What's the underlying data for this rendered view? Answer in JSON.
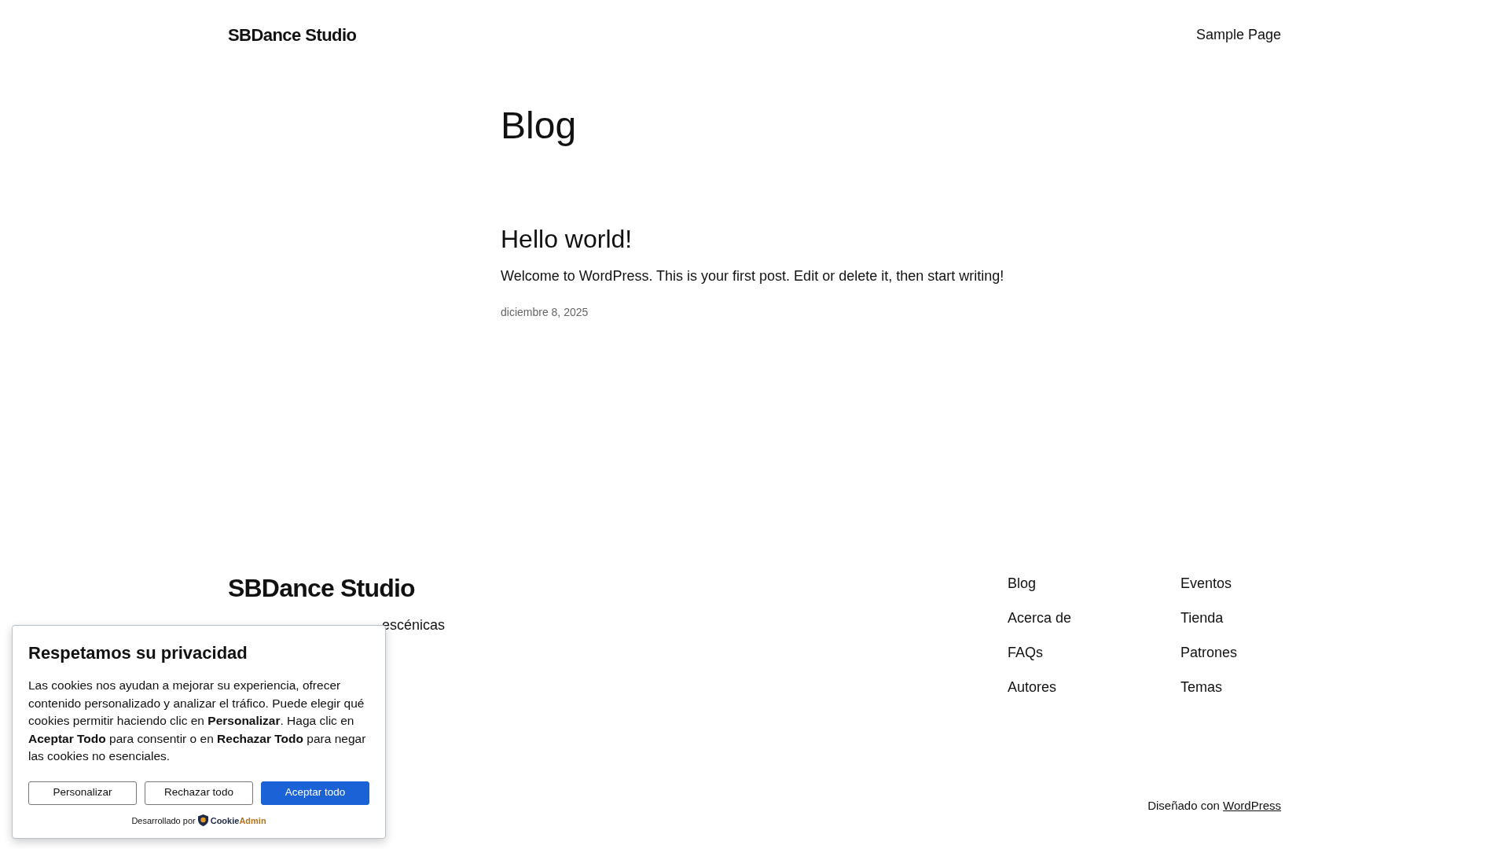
{
  "header": {
    "site_title": "SBDance Studio",
    "nav": [
      "Sample Page"
    ]
  },
  "page_title": "Blog",
  "posts": [
    {
      "title": "Hello world!",
      "excerpt": "Welcome to WordPress. This is your first post. Edit or delete it, then start writing!",
      "date": "diciembre 8, 2025"
    }
  ],
  "footer": {
    "site_title": "SBDance Studio",
    "tagline_visible": "escénicas",
    "nav_columns": [
      [
        "Blog",
        "Acerca de",
        "FAQs",
        "Autores"
      ],
      [
        "Eventos",
        "Tienda",
        "Patrones",
        "Temas"
      ]
    ],
    "credit": {
      "text": "Diseñado con",
      "link": "WordPress"
    }
  },
  "cookie_banner": {
    "title": "Respetamos su privacidad",
    "body": "Las cookies nos ayudan a mejorar su experiencia, ofrecer contenido personalizado y analizar el tráfico. Puede elegir qué cookies permitir haciendo clic en **Personalizar**. Haga clic en **Aceptar Todo** para consentir o en **Rechazar Todo** para negar las cookies no esenciales.",
    "buttons": [
      {
        "label": "Personalizar",
        "kind": "outline"
      },
      {
        "label": "Rechazar todo",
        "kind": "outline"
      },
      {
        "label": "Aceptar todo",
        "kind": "primary"
      }
    ],
    "powered_by": "Desarrollado por",
    "brand": {
      "part_1": "Cookie",
      "part_2": "Admin"
    }
  }
}
